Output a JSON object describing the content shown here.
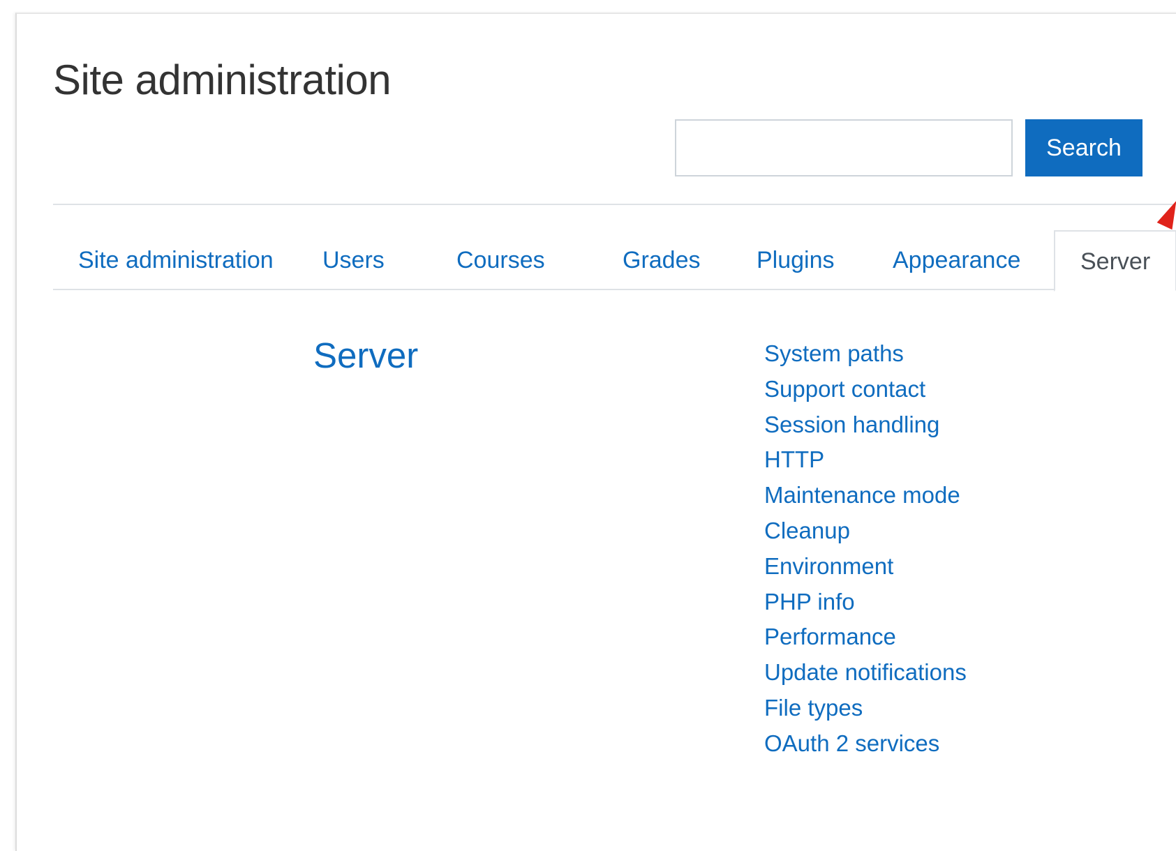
{
  "header": {
    "title": "Site administration"
  },
  "search": {
    "value": "",
    "placeholder": "",
    "button_label": "Search"
  },
  "tabs": [
    {
      "label": "Site administration",
      "active": false
    },
    {
      "label": "Users",
      "active": false
    },
    {
      "label": "Courses",
      "active": false
    },
    {
      "label": "Grades",
      "active": false
    },
    {
      "label": "Plugins",
      "active": false
    },
    {
      "label": "Appearance",
      "active": false
    },
    {
      "label": "Server",
      "active": true
    }
  ],
  "section": {
    "heading": "Server",
    "links": [
      "System paths",
      "Support contact",
      "Session handling",
      "HTTP",
      "Maintenance mode",
      "Cleanup",
      "Environment",
      "PHP info",
      "Performance",
      "Update notifications",
      "File types",
      "OAuth 2 services"
    ]
  },
  "colors": {
    "link": "#0f6cbf",
    "button": "#0f6cbf",
    "text": "#333333",
    "annotation_arrow": "#e0231b"
  }
}
